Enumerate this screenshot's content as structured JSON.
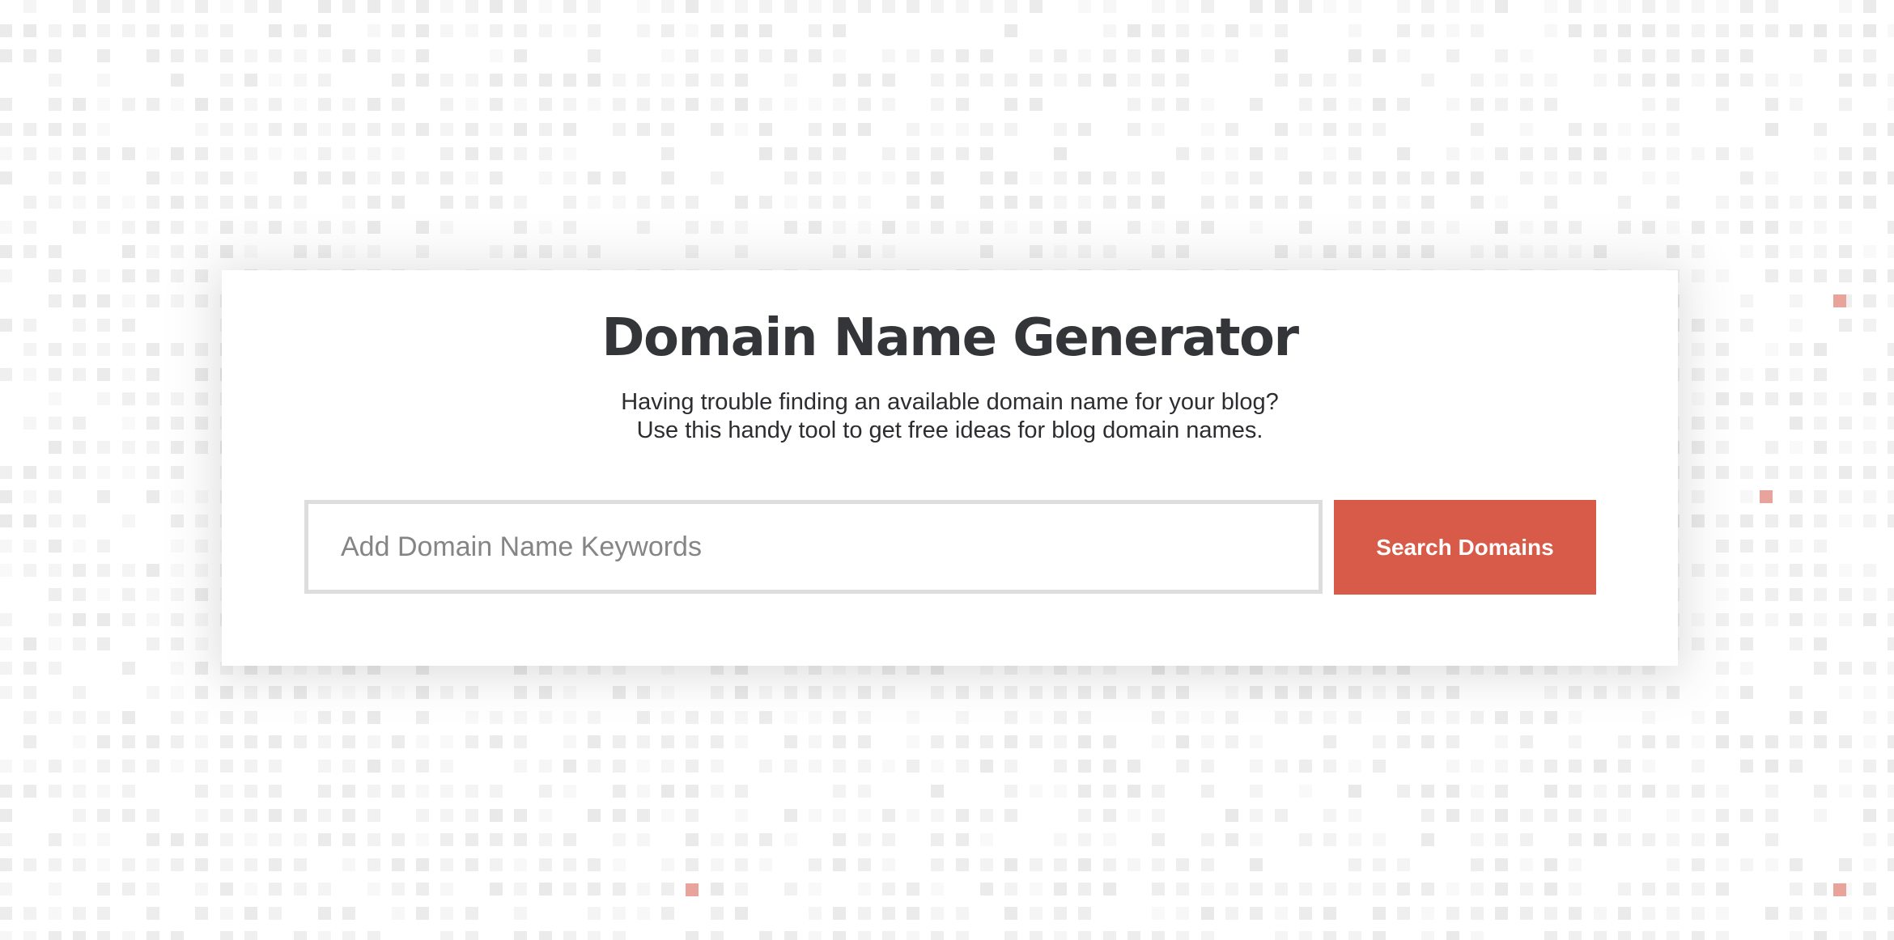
{
  "hero": {
    "title": "Domain Name Generator",
    "subtitle_line1": "Having trouble finding an available domain name for your blog?",
    "subtitle_line2": "Use this handy tool to get free ideas for blog domain names."
  },
  "search": {
    "input_value": "",
    "placeholder": "Add Domain Name Keywords",
    "button_label": "Search Domains"
  },
  "colors": {
    "accent": "#d85a48",
    "title_text": "#333538",
    "input_border": "#dddddd",
    "placeholder_text": "#858585",
    "grid_square": "#e9e9e9",
    "grid_accent_square": "#e8a39a"
  },
  "background": {
    "pattern": "square-grid",
    "accent_squares": 4
  }
}
